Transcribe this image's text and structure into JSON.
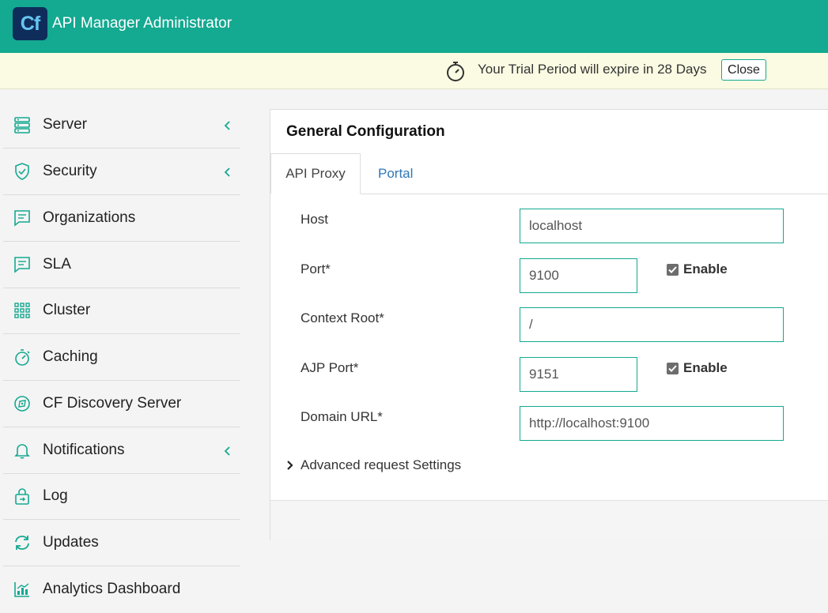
{
  "header": {
    "logo_text": "Cf",
    "title": "API Manager Administrator"
  },
  "trial": {
    "message": "Your Trial Period will expire in 28 Days",
    "close_label": "Close",
    "icon": "stopwatch-icon"
  },
  "sidebar": {
    "items": [
      {
        "label": "Server",
        "icon": "server-icon",
        "expandable": true
      },
      {
        "label": "Security",
        "icon": "shield-icon",
        "expandable": true
      },
      {
        "label": "Organizations",
        "icon": "chat-icon",
        "expandable": false
      },
      {
        "label": "SLA",
        "icon": "chat-icon",
        "expandable": false
      },
      {
        "label": "Cluster",
        "icon": "grid-icon",
        "expandable": false
      },
      {
        "label": "Caching",
        "icon": "timer-icon",
        "expandable": false
      },
      {
        "label": "CF Discovery Server",
        "icon": "compass-icon",
        "expandable": false
      },
      {
        "label": "Notifications",
        "icon": "bell-icon",
        "expandable": true
      },
      {
        "label": "Log",
        "icon": "lock-icon",
        "expandable": false
      },
      {
        "label": "Updates",
        "icon": "refresh-icon",
        "expandable": false
      },
      {
        "label": "Analytics Dashboard",
        "icon": "chart-icon",
        "expandable": false
      }
    ]
  },
  "panel": {
    "title": "General Configuration",
    "tabs": [
      {
        "label": "API Proxy",
        "active": true
      },
      {
        "label": "Portal",
        "active": false
      }
    ],
    "fields": {
      "host": {
        "label": "Host",
        "value": "localhost"
      },
      "port": {
        "label": "Port*",
        "value": "9100",
        "enable_label": "Enable",
        "enabled": true
      },
      "context_root": {
        "label": "Context Root*",
        "value": "/"
      },
      "ajp_port": {
        "label": "AJP Port*",
        "value": "9151",
        "enable_label": "Enable",
        "enabled": true
      },
      "domain_url": {
        "label": "Domain URL*",
        "value": "http://localhost:9100"
      }
    },
    "advanced_label": "Advanced request Settings"
  },
  "colors": {
    "brand": "#14a991",
    "logo_bg": "#0f2d5b",
    "banner_bg": "#fbfbe3",
    "link": "#2f77b6"
  }
}
